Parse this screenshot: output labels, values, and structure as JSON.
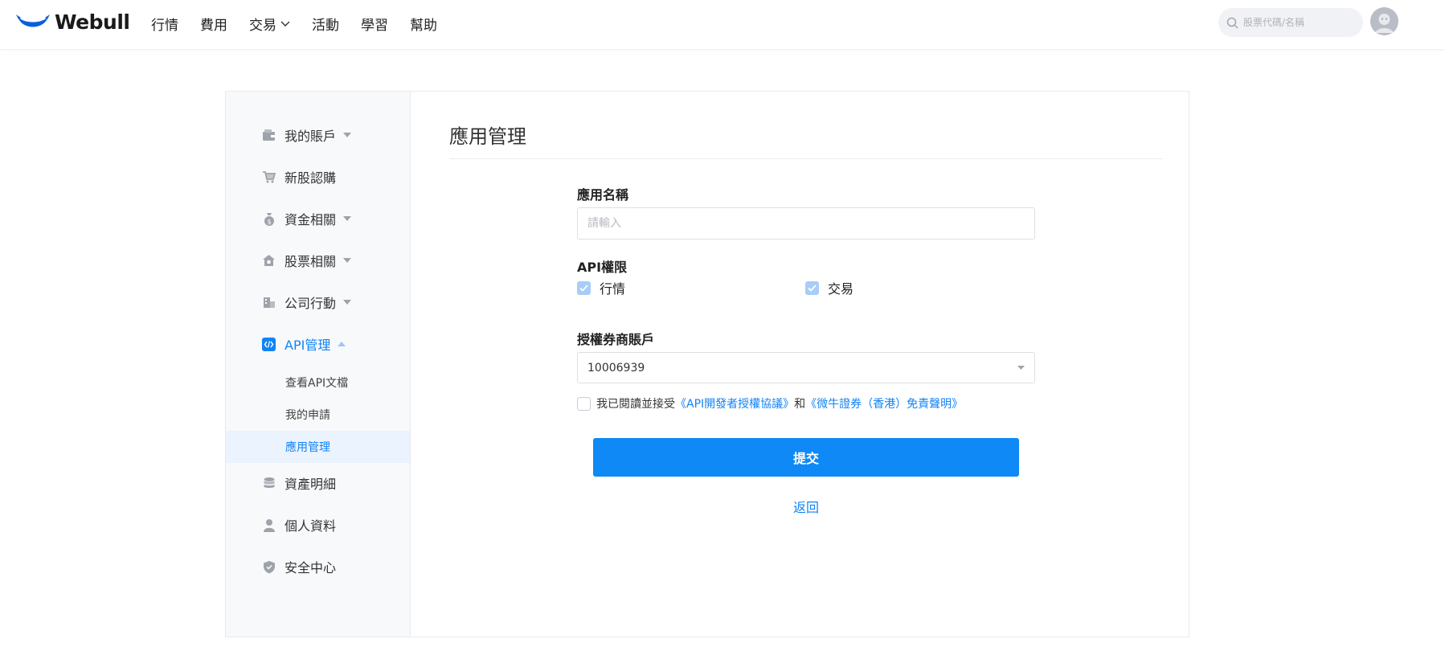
{
  "brand": {
    "name": "Webull",
    "accent": "#1183f5",
    "button_color": "#0f89f5"
  },
  "nav": {
    "items": [
      {
        "label": "行情"
      },
      {
        "label": "費用"
      },
      {
        "label": "交易"
      },
      {
        "label": "活動"
      },
      {
        "label": "學習"
      },
      {
        "label": "幫助"
      }
    ],
    "search_placeholder": "股票代碼/名稱"
  },
  "sidebar": {
    "items": [
      {
        "label": "我的賬戶",
        "icon": "wallet-icon"
      },
      {
        "label": "新股認購",
        "icon": "cart-icon"
      },
      {
        "label": "資金相關",
        "icon": "money-bag-icon"
      },
      {
        "label": "股票相關",
        "icon": "house-icon"
      },
      {
        "label": "公司行動",
        "icon": "building-icon"
      },
      {
        "label": "API管理",
        "icon": "api-code-icon"
      },
      {
        "label": "資產明細",
        "icon": "coins-stack-icon"
      },
      {
        "label": "個人資料",
        "icon": "person-icon"
      },
      {
        "label": "安全中心",
        "icon": "shield-icon"
      }
    ],
    "api_subitems": [
      {
        "label": "查看API文檔"
      },
      {
        "label": "我的申請"
      },
      {
        "label": "應用管理"
      }
    ],
    "active_subitem": "應用管理"
  },
  "main": {
    "title": "應用管理",
    "app_name_label": "應用名稱",
    "app_name_placeholder": "請輸入",
    "app_name_value": "",
    "api_permission_label": "API權限",
    "permissions": [
      {
        "label": "行情",
        "checked": true
      },
      {
        "label": "交易",
        "checked": true
      }
    ],
    "account_label": "授權券商賬戶",
    "account_value": "10006939",
    "agreement": {
      "prefix": "我已閱讀並接受",
      "link1": "《API開發者授權協議》",
      "joiner": "和",
      "link2": "《微牛證券（香港）免責聲明》",
      "checked": false
    },
    "submit_label": "提交",
    "back_label": "返回"
  }
}
